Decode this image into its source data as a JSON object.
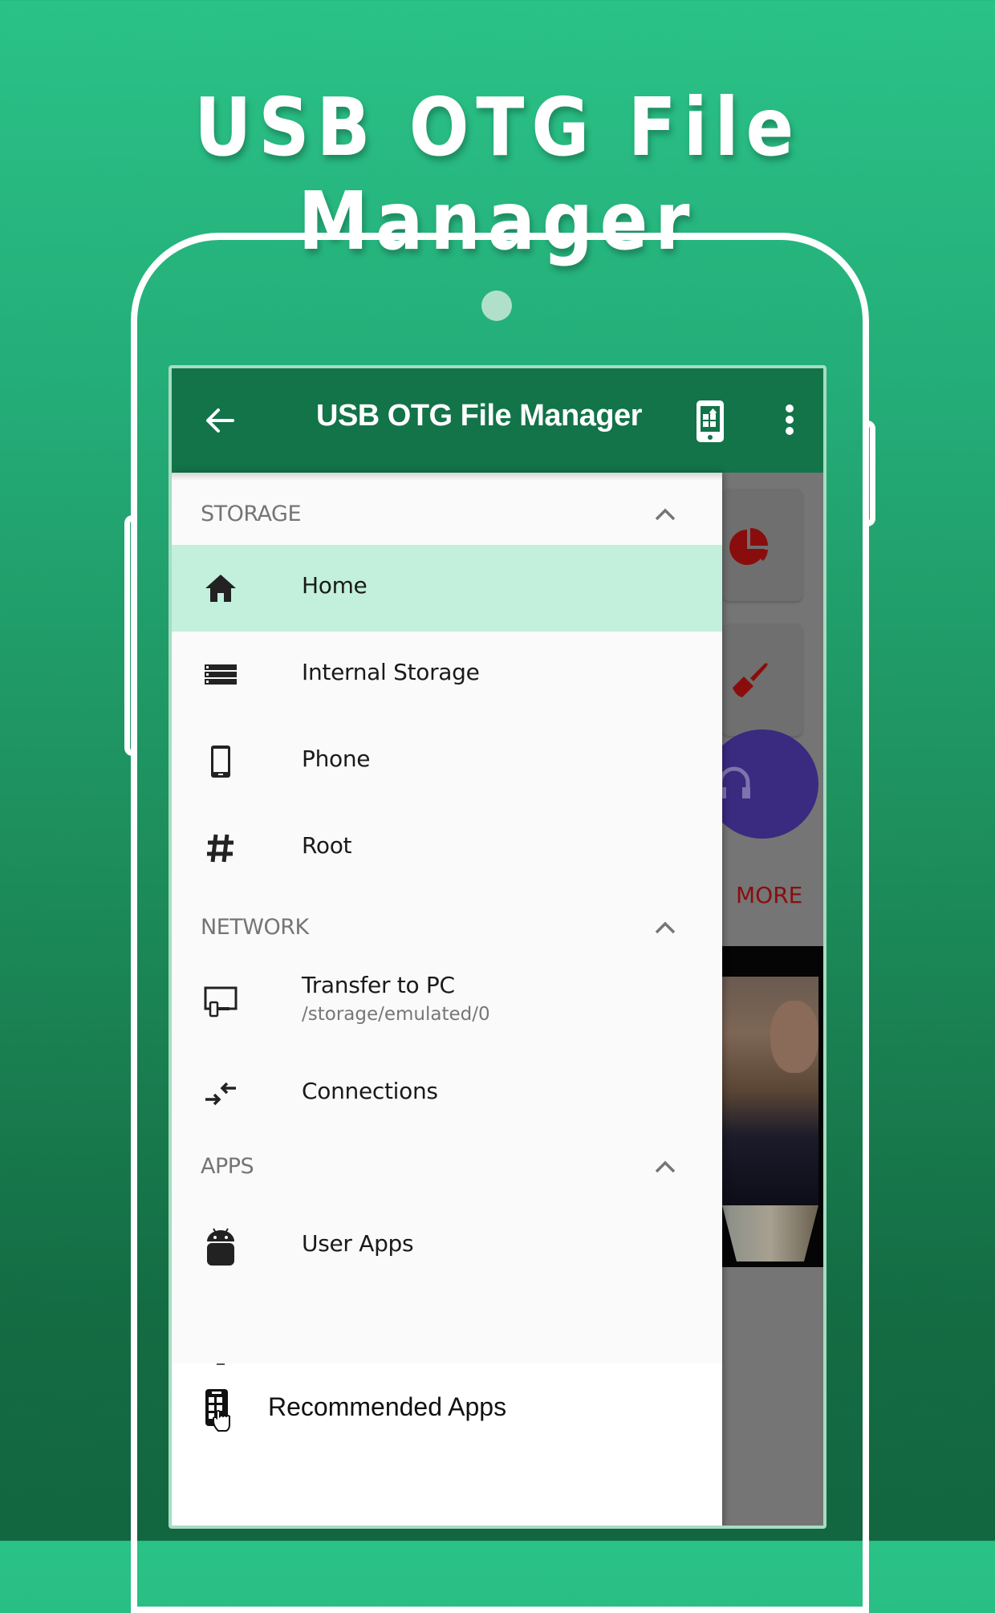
{
  "promo": {
    "headline": "USB OTG File Manager"
  },
  "toolbar": {
    "back_icon": "arrow-left-icon",
    "title": "USB OTG File Manager",
    "device_icon": "phone-apps-icon",
    "more_icon": "more-vert-icon"
  },
  "drawer": {
    "sections": [
      {
        "label": "STORAGE",
        "expanded": true,
        "items": [
          {
            "label": "Home",
            "icon": "home-icon",
            "active": true
          },
          {
            "label": "Internal Storage",
            "icon": "storage-icon"
          },
          {
            "label": "Phone",
            "icon": "smartphone-icon"
          },
          {
            "label": "Root",
            "icon": "hash-icon"
          }
        ]
      },
      {
        "label": "NETWORK",
        "expanded": true,
        "items": [
          {
            "label": "Transfer to PC",
            "sublabel": "/storage/emulated/0",
            "icon": "devices-icon"
          },
          {
            "label": "Connections",
            "icon": "compare-arrows-icon"
          }
        ]
      },
      {
        "label": "APPS",
        "expanded": true,
        "items": [
          {
            "label": "User Apps",
            "icon": "android-icon"
          }
        ]
      }
    ],
    "footer": {
      "label": "Recommended Apps",
      "icon": "phone-touch-icon"
    }
  },
  "background": {
    "more_label": "MORE",
    "card_icons": [
      "pie-chart-icon",
      "brush-icon"
    ],
    "circle_icon": "headphones-icon"
  },
  "colors": {
    "toolbar": "#137349",
    "active_item": "#c2f0dd",
    "bg_top": "#2ac287",
    "bg_bottom": "#126640",
    "accent_red": "#8a0d0d",
    "music_circle": "#3a2a80"
  }
}
